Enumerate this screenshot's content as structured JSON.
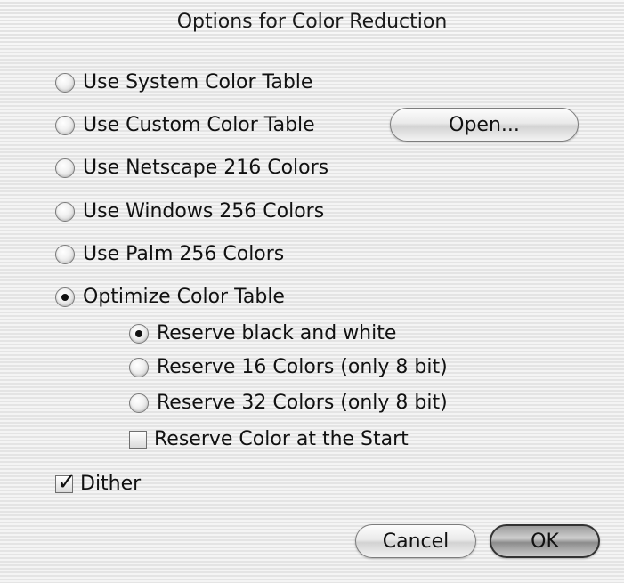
{
  "dialog": {
    "title": "Options for Color Reduction",
    "options": [
      {
        "label": "Use System Color Table",
        "selected": false
      },
      {
        "label": "Use Custom Color Table",
        "selected": false
      },
      {
        "label": "Use Netscape 216 Colors",
        "selected": false
      },
      {
        "label": "Use Windows 256 Colors",
        "selected": false
      },
      {
        "label": "Use Palm 256 Colors",
        "selected": false
      },
      {
        "label": "Optimize Color Table",
        "selected": true
      }
    ],
    "open_label": "Open...",
    "sub_options": [
      {
        "label": "Reserve black and white",
        "selected": true
      },
      {
        "label": "Reserve 16 Colors (only 8 bit)",
        "selected": false
      },
      {
        "label": "Reserve 32 Colors (only 8 bit)",
        "selected": false
      }
    ],
    "reserve_start": {
      "label": "Reserve Color at the Start",
      "checked": false
    },
    "dither": {
      "label": "Dither",
      "checked": true
    },
    "cancel_label": "Cancel",
    "ok_label": "OK"
  }
}
